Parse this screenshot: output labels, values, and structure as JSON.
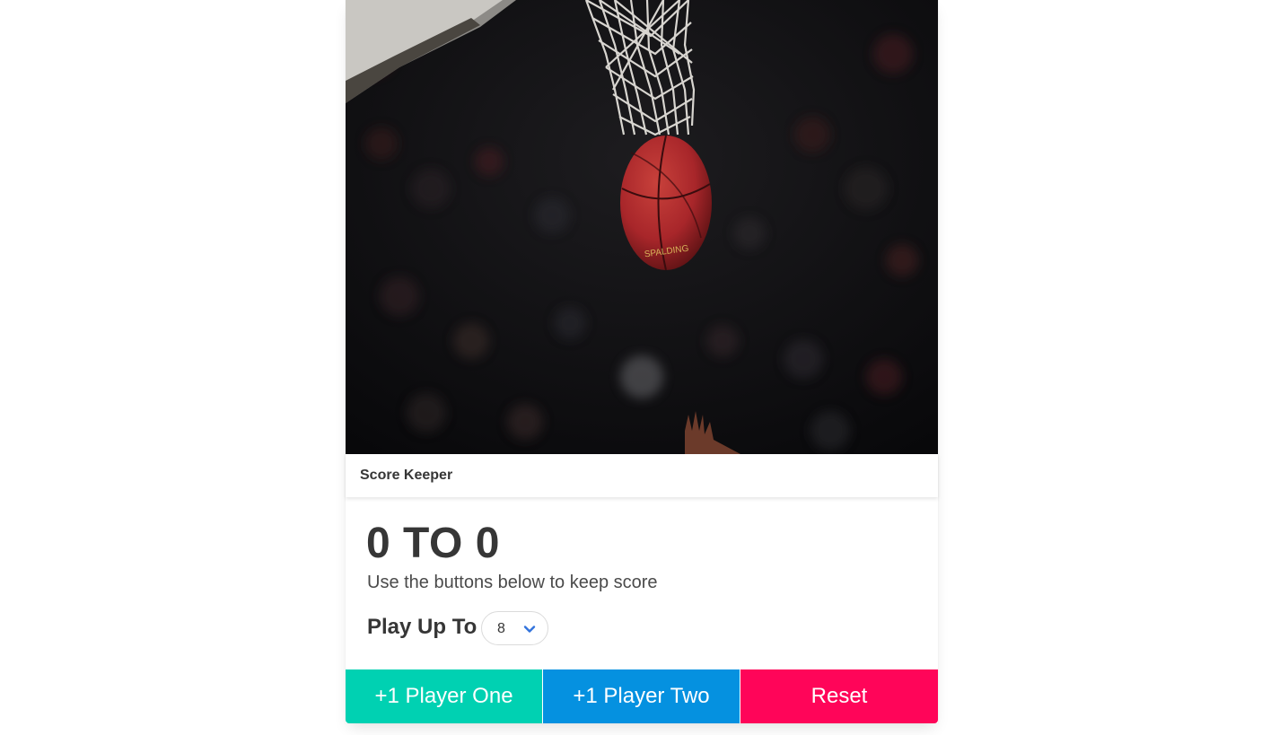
{
  "card": {
    "header_title": "Score Keeper"
  },
  "hero": {
    "image_subject": "basketball-falling-through-net-photo"
  },
  "scoreboard": {
    "player_one_score": "0",
    "separator": "TO",
    "player_two_score": "0",
    "display": "0 TO 0",
    "instructions": "Use the buttons below to keep score"
  },
  "play_up_to": {
    "label": "Play Up To",
    "selected_value": "8",
    "icon": "chevron-down-icon"
  },
  "buttons": {
    "player_one_label": "+1 Player One",
    "player_two_label": "+1 Player Two",
    "reset_label": "Reset"
  },
  "colors": {
    "player_one": "#00d1b2",
    "player_two": "#0591e0",
    "reset": "#ff0559",
    "text_dark": "#363636"
  }
}
